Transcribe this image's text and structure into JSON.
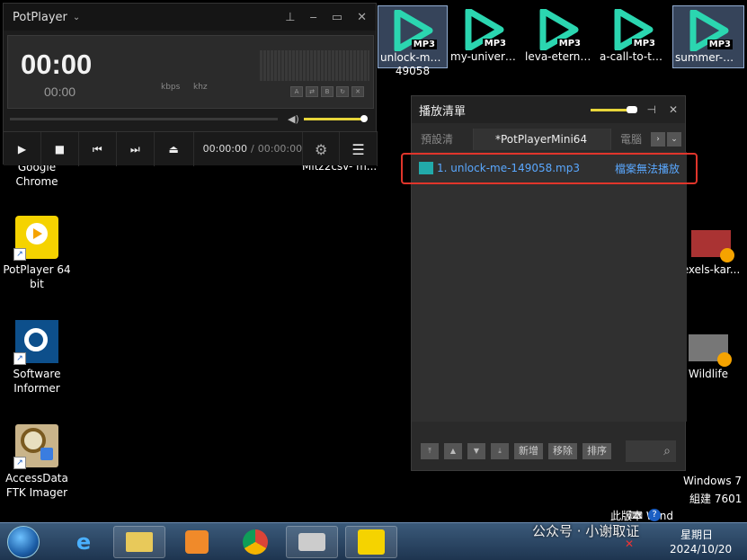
{
  "player": {
    "title": "PotPlayer",
    "big_time": "00:00",
    "small_time": "00:00",
    "kbps_label": "kbps",
    "khz_label": "khz",
    "current_time": "00:00:00",
    "separator": "/",
    "total_time": "00:00:00",
    "volume_percent": 92
  },
  "playlist": {
    "title": "播放清單",
    "tabs": [
      {
        "label": "預設清單"
      },
      {
        "label": "*PotPlayerMini64"
      },
      {
        "label": "電腦"
      }
    ],
    "items": [
      {
        "name": "1. unlock-me-149058.mp3",
        "status": "檔案無法播放"
      }
    ],
    "footer_buttons": [
      "新增",
      "移除",
      "排序"
    ]
  },
  "desktop": {
    "mp3_files": [
      {
        "label1": "unlock-me-1",
        "label2": "49058",
        "badge": "MP3",
        "selected": true
      },
      {
        "label1": "my-univers...",
        "label2": "",
        "badge": "MP3",
        "selected": false
      },
      {
        "label1": "leva-eternit...",
        "label2": "",
        "badge": "MP3",
        "selected": false
      },
      {
        "label1": "a-call-to-th...",
        "label2": "",
        "badge": "MP3",
        "selected": false
      },
      {
        "label1": "summer-wa...",
        "label2": "",
        "badge": "MP3",
        "selected": true
      }
    ],
    "left_icons": [
      {
        "label": "Google Chrome"
      },
      {
        "label": "PotPlayer 64 bit"
      },
      {
        "label": "Software Informer"
      },
      {
        "label": "AccessData FTK Imager"
      }
    ],
    "right_icons": [
      {
        "label": "exels-kar..."
      },
      {
        "label": "Wildlife"
      }
    ],
    "partial_label": "Mitz2csv- m..."
  },
  "os": {
    "win_name": "Windows 7",
    "build": "組建 7601",
    "version_notice": "此版本 Wind",
    "watermark": "公众号 · 小谢取证",
    "clock_date": "2024/10/20",
    "clock_day": "星期日"
  }
}
